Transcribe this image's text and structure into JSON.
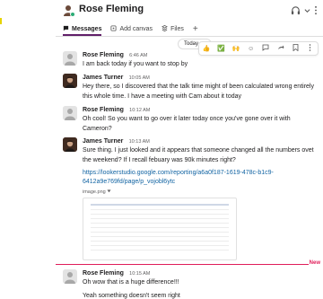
{
  "header": {
    "title": "Rose Fleming",
    "headphones_icon": "headphones-icon",
    "chevron_icon": "chevron-down-icon",
    "more_icon": "more-vertical-icon"
  },
  "tabs": [
    {
      "label": "Messages",
      "icon": "chat-bubble-icon",
      "active": true
    },
    {
      "label": "Add canvas",
      "icon": "canvas-icon",
      "active": false
    },
    {
      "label": "Files",
      "icon": "files-icon",
      "active": false
    }
  ],
  "date_pill": {
    "label": "Today"
  },
  "messages": [
    {
      "author": "Rose Fleming",
      "time": "6:46 AM",
      "text": "I am back today if you want to stop by"
    },
    {
      "author": "James Turner",
      "time": "10:05 AM",
      "text": "Hey there, so I discovered that the talk time might of been calculated wrong entirely this whole time. I have a meeting with Cam about it today"
    },
    {
      "author": "Rose Fleming",
      "time": "10:12 AM",
      "text": "Oh cool!  So you want to  go over it later today once you've gone over it with Cameron?"
    },
    {
      "author": "James Turner",
      "time": "10:13 AM",
      "text": "Sure thing. I just looked and it appears that someone changed all the numbers ovet the weekend? If I recall febuary was 90k minutes right?",
      "link": "https://lookerstudio.google.com/reporting/a6a0f187-1619-478c-b1c9-6412a9e769fd/page/p_vojobl6ytc",
      "attachment": "image.png"
    },
    {
      "author": "Rose Fleming",
      "time": "10:15 AM",
      "text": "Oh wow that is a huge difference!!!",
      "text2": "Yeah something doesn't seem right"
    }
  ],
  "new_label": "New",
  "colors": {
    "accent": "#611f69",
    "link": "#1264a3",
    "new": "#e01e5a",
    "presence": "#2bac76"
  }
}
